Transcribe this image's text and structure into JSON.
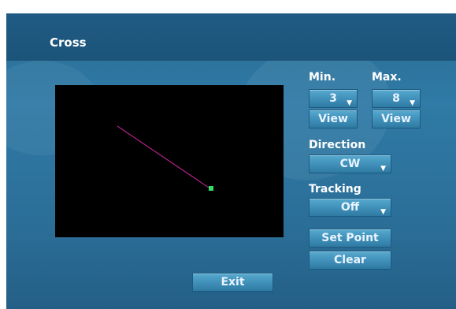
{
  "window": {
    "title": "Cross"
  },
  "preview": {
    "line_color": "#b0208a",
    "point_color": "#33dd66"
  },
  "min": {
    "label": "Min.",
    "value": "3",
    "view_label": "View"
  },
  "max": {
    "label": "Max.",
    "value": "8",
    "view_label": "View"
  },
  "direction": {
    "label": "Direction",
    "value": "CW"
  },
  "tracking": {
    "label": "Tracking",
    "value": "Off"
  },
  "buttons": {
    "set_point": "Set Point",
    "clear": "Clear",
    "exit": "Exit"
  },
  "icons": {
    "dropdown": "caret-down-icon"
  }
}
